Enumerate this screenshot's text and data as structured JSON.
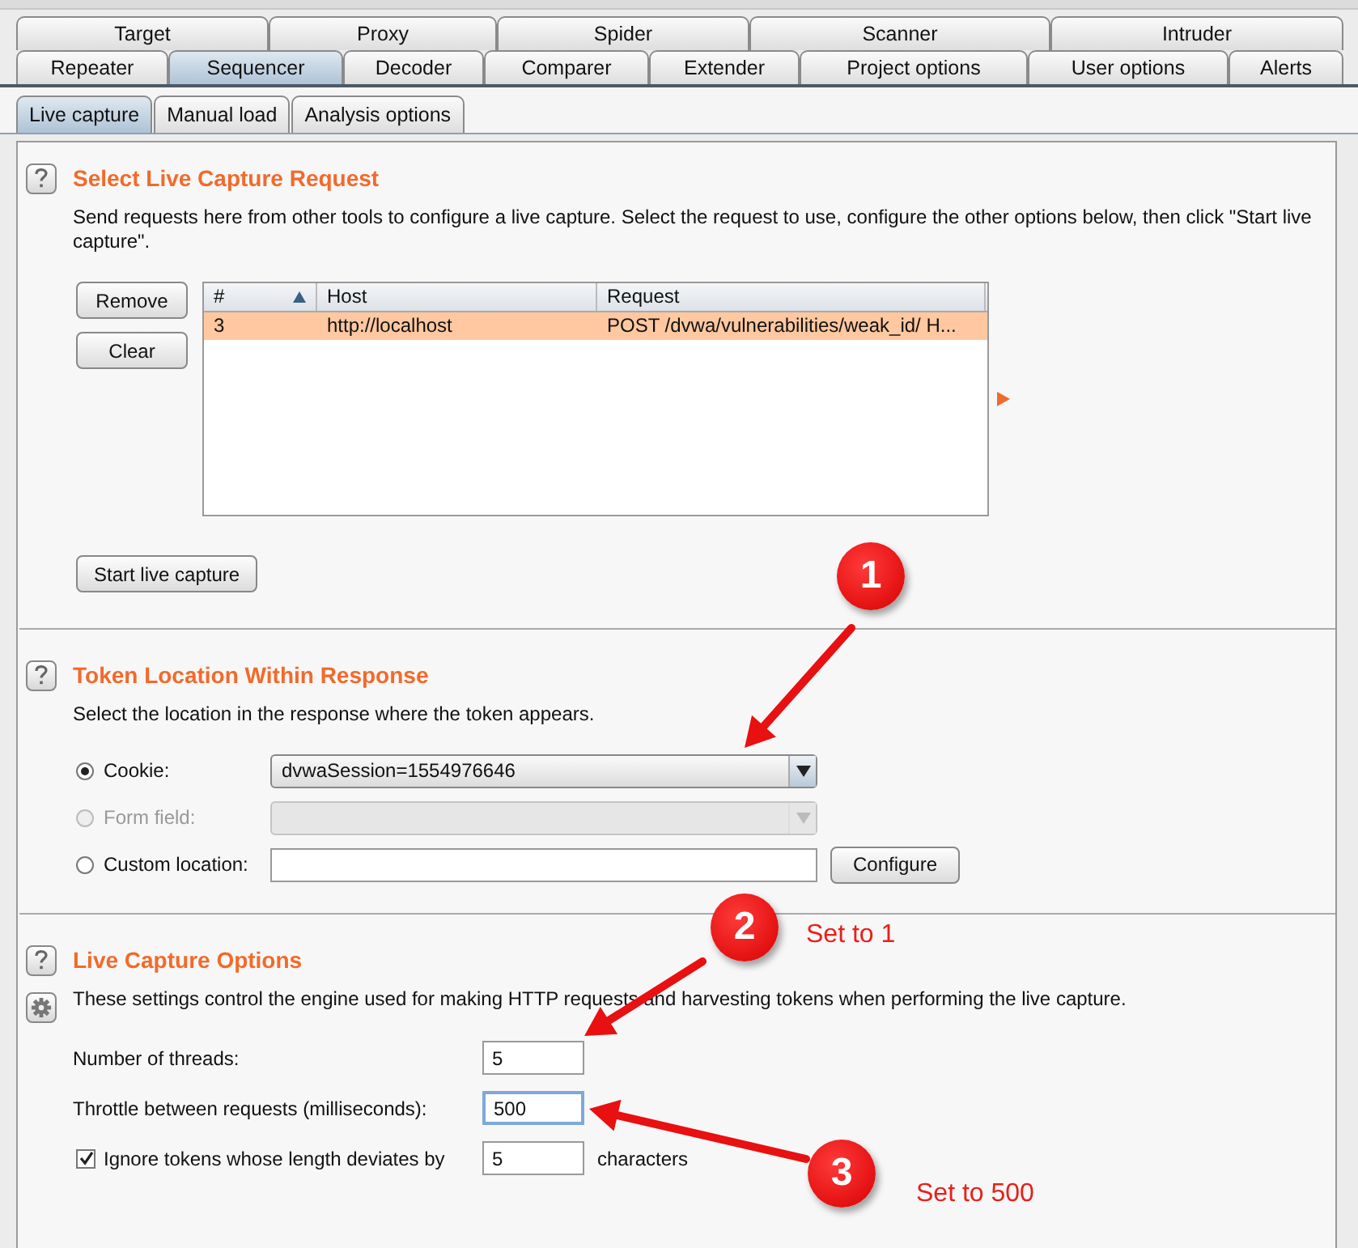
{
  "tab_rows": [
    {
      "tabs": [
        {
          "label": "Target",
          "selected": false
        },
        {
          "label": "Proxy",
          "selected": false
        },
        {
          "label": "Spider",
          "selected": false
        },
        {
          "label": "Scanner",
          "selected": false
        },
        {
          "label": "Intruder",
          "selected": false
        }
      ]
    },
    {
      "tabs": [
        {
          "label": "Repeater",
          "selected": false
        },
        {
          "label": "Sequencer",
          "selected": true
        },
        {
          "label": "Decoder",
          "selected": false
        },
        {
          "label": "Comparer",
          "selected": false
        },
        {
          "label": "Extender",
          "selected": false
        },
        {
          "label": "Project options",
          "selected": false
        },
        {
          "label": "User options",
          "selected": false
        },
        {
          "label": "Alerts",
          "selected": false
        }
      ]
    }
  ],
  "subtabs": [
    {
      "label": "Live capture",
      "selected": true
    },
    {
      "label": "Manual load",
      "selected": false
    },
    {
      "label": "Analysis options",
      "selected": false
    }
  ],
  "capture_request": {
    "title": "Select Live Capture Request",
    "description": "Send requests here from other tools to configure a live capture. Select the request to use, configure the other options below, then click \"Start live capture\".",
    "buttons": [
      "Remove",
      "Clear"
    ],
    "table": {
      "columns": [
        {
          "label": "#",
          "sorted": true
        },
        {
          "label": "Host",
          "sorted": false
        },
        {
          "label": "Request",
          "sorted": false
        }
      ],
      "rows": [
        {
          "cells": [
            "3",
            "http://localhost",
            "POST /dvwa/vulnerabilities/weak_id/ H..."
          ],
          "selected": true
        }
      ]
    },
    "start_button": "Start live capture"
  },
  "token_location": {
    "title": "Token Location Within Response",
    "description": "Select the location in the response where the token appears.",
    "options": [
      {
        "kind": "dropdown",
        "label": "Cookie:",
        "selected": true,
        "disabled": false,
        "value": "dvwaSession=1554976646"
      },
      {
        "kind": "dropdown",
        "label": "Form field:",
        "selected": false,
        "disabled": true
      },
      {
        "kind": "text",
        "label": "Custom location:",
        "selected": false,
        "disabled": false,
        "button": "Configure"
      }
    ]
  },
  "capture_options": {
    "title": "Live Capture Options",
    "description": "These settings control the engine used for making HTTP requests and harvesting tokens when performing the live capture.",
    "fields": [
      {
        "kind": "number",
        "label": "Number of threads:",
        "value": "5",
        "focused": false
      },
      {
        "kind": "number",
        "label": "Throttle between requests (milliseconds):",
        "value": "500",
        "focused": true
      },
      {
        "kind": "checkbox",
        "label": "Ignore tokens whose length deviates by",
        "checked": true,
        "value": "5",
        "suffix": "characters"
      }
    ]
  },
  "annotations": [
    {
      "number": "1"
    },
    {
      "number": "2",
      "note": "Set to 1"
    },
    {
      "number": "3",
      "note": "Set to 500"
    }
  ]
}
